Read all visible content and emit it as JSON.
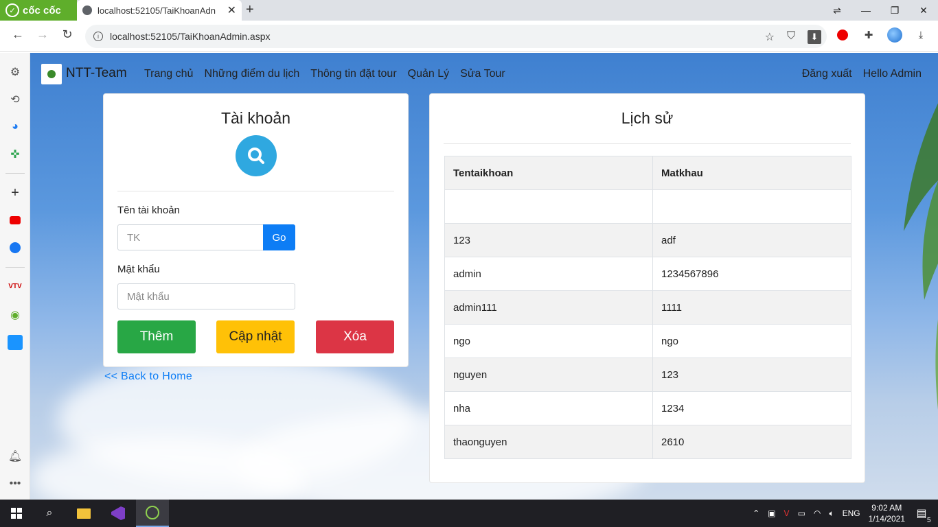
{
  "browser": {
    "logo_text": "cốc cốc",
    "tab_title": "localhost:52105/TaiKhoanAdn",
    "url": "localhost:52105/TaiKhoanAdmin.aspx"
  },
  "navbar": {
    "brand": "NTT-Team",
    "links": [
      "Trang chủ",
      "Những điểm du lịch",
      "Thông tin đặt tour",
      "Quản Lý",
      "Sửa Tour"
    ],
    "logout": "Đăng xuất",
    "greeting": "Hello Admin"
  },
  "account_card": {
    "title": "Tài khoản",
    "username_label": "Tên tài khoản",
    "username_placeholder": "TK",
    "go_label": "Go",
    "password_label": "Mật khẩu",
    "password_placeholder": "Mật khẩu",
    "add_label": "Thêm",
    "update_label": "Cập nhật",
    "delete_label": "Xóa"
  },
  "back_link": "<< Back to Home",
  "history_card": {
    "title": "Lịch sử",
    "columns": [
      "Tentaikhoan",
      "Matkhau"
    ],
    "rows": [
      [
        "",
        ""
      ],
      [
        "123",
        "adf"
      ],
      [
        "admin",
        "1234567896"
      ],
      [
        "admin111",
        "1111"
      ],
      [
        "ngo",
        "ngo"
      ],
      [
        "nguyen",
        "123"
      ],
      [
        "nha",
        "1234"
      ],
      [
        "thaonguyen",
        "2610"
      ]
    ]
  },
  "taskbar": {
    "language": "ENG",
    "time": "9:02 AM",
    "date": "1/14/2021",
    "notification_count": "5"
  },
  "colors": {
    "primary": "#0d7df5",
    "success": "#28a745",
    "warning": "#ffc107",
    "danger": "#dc3545",
    "accent_circle": "#2fa8e0",
    "coccoc_green": "#5fae2b"
  }
}
